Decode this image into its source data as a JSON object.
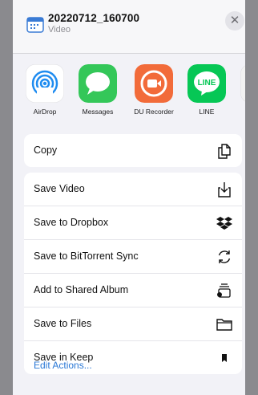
{
  "header": {
    "title": "20220712_160700",
    "subtitle": "Video",
    "close_glyph": "✕",
    "file_icon": "video-file-icon"
  },
  "apps": [
    {
      "label": "AirDrop",
      "icon": "airdrop-icon",
      "color": "#ffffff"
    },
    {
      "label": "Messages",
      "icon": "messages-icon",
      "color": "#34c759"
    },
    {
      "label": "DU Recorder",
      "icon": "du-recorder-icon",
      "color": "#f26b3a"
    },
    {
      "label": "LINE",
      "icon": "line-icon",
      "color": "#06c755"
    },
    {
      "label": "",
      "icon": "app-icon",
      "color": "#f2f2f2"
    }
  ],
  "copy_action": {
    "label": "Copy",
    "icon": "copy-icon"
  },
  "actions": [
    {
      "label": "Save Video",
      "icon": "save-video-icon"
    },
    {
      "label": "Save to Dropbox",
      "icon": "dropbox-icon"
    },
    {
      "label": "Save to BitTorrent Sync",
      "icon": "sync-icon"
    },
    {
      "label": "Add to Shared Album",
      "icon": "shared-album-icon"
    },
    {
      "label": "Save to Files",
      "icon": "folder-icon"
    },
    {
      "label": "Save in Keep",
      "icon": "bookmark-icon"
    }
  ],
  "edit_actions": "Edit Actions...",
  "colors": {
    "link": "#2a78d6",
    "background": "#f2f2f7"
  }
}
